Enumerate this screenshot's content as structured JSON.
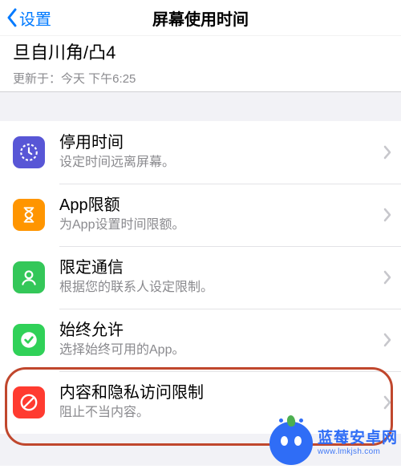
{
  "header": {
    "back_label": "设置",
    "title": "屏幕使用时间"
  },
  "top_section": {
    "partial_row_text": "旦自川角/凸4",
    "updated_prefix": "更新于：",
    "updated_value": "今天 下午6:25"
  },
  "rows": [
    {
      "icon": "downtime-clock-icon",
      "icon_color": "#5856d6",
      "title": "停用时间",
      "subtitle": "设定时间远离屏幕。"
    },
    {
      "icon": "hourglass-icon",
      "icon_color": "#ff9500",
      "title": "App限额",
      "subtitle": "为App设置时间限额。"
    },
    {
      "icon": "contact-person-icon",
      "icon_color": "#34c759",
      "title": "限定通信",
      "subtitle": "根据您的联系人设定限制。"
    },
    {
      "icon": "checkmark-shield-icon",
      "icon_color": "#30d158",
      "title": "始终允许",
      "subtitle": "选择始终可用的App。"
    },
    {
      "icon": "no-entry-icon",
      "icon_color": "#ff3b30",
      "title": "内容和隐私访问限制",
      "subtitle": "阻止不当内容。"
    }
  ],
  "watermark": {
    "name_cn": "蓝莓安卓网",
    "name_en": "www.lmkjsh.com"
  }
}
